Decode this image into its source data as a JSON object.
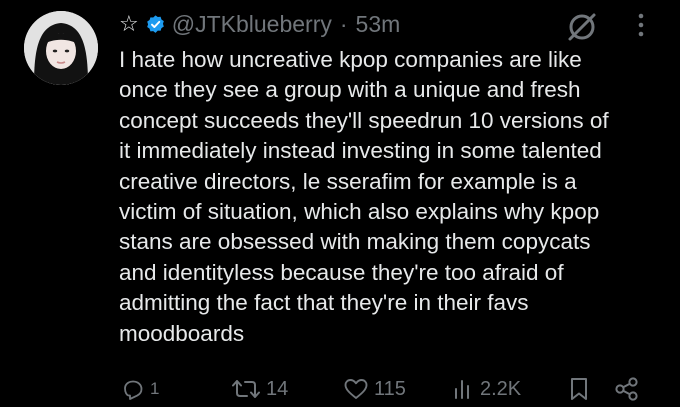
{
  "tweet": {
    "display_name_icon": "star-outline-icon",
    "handle": "@JTKblueberry",
    "separator": "·",
    "time": "53m",
    "text": "I hate how uncreative kpop companies are like\nonce they see a group with a unique and fresh\nconcept succeeds they'll speedrun 10 versions of\nit immediately instead investing in some talented\ncreative directors, le sserafim for example is a\nvictim of situation, which also explains why kpop\nstans are obsessed with making them copycats\nand identityless because they're too afraid of\nadmitting the fact that they're in their favs\nmoodboards"
  },
  "actions": {
    "replies": "1",
    "retweets": "14",
    "likes": "115",
    "views": "2.2K"
  },
  "colors": {
    "background": "#000000",
    "text": "#e7e9ea",
    "muted": "#71767b",
    "verified": "#1d9bf0"
  }
}
